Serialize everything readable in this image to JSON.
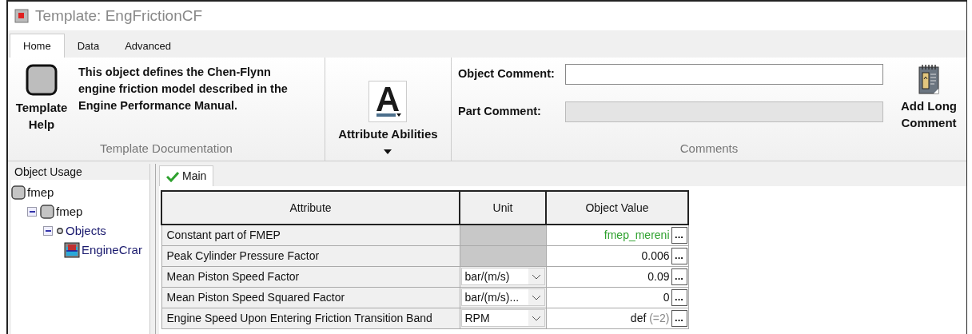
{
  "window": {
    "title": "Template: EngFrictionCF"
  },
  "tabs": [
    {
      "label": "Home",
      "selected": true
    },
    {
      "label": "Data",
      "selected": false
    },
    {
      "label": "Advanced",
      "selected": false
    }
  ],
  "ribbon": {
    "template_help": "Template Help",
    "description": "This object defines the Chen-Flynn engine friction model described in the Engine Performance Manual.",
    "documentation_group": "Template Documentation",
    "attribute_abilities": "Attribute Abilities",
    "comments": [
      {
        "label": "Object Comment:",
        "disabled": false
      },
      {
        "label": "Part Comment:",
        "disabled": true
      }
    ],
    "add_long_comment": "Add Long Comment",
    "comments_group": "Comments"
  },
  "object_usage": {
    "title": "Object Usage",
    "tree": [
      {
        "label": "fmep",
        "kind": "template",
        "children": [
          {
            "label": "fmep",
            "kind": "template",
            "expanded": true,
            "children": [
              {
                "label": "Objects",
                "kind": "folder",
                "expanded": true,
                "children": [
                  {
                    "label": "EngineCrar",
                    "kind": "object"
                  }
                ]
              }
            ]
          }
        ]
      }
    ]
  },
  "main": {
    "tab": "Main",
    "columns": [
      "Attribute",
      "Unit",
      "Object Value"
    ],
    "rows": [
      {
        "attribute": "Constant part of FMEP",
        "unit": {
          "kind": "none"
        },
        "value": {
          "kind": "reference",
          "text": "fmep_mereni"
        },
        "button": "..."
      },
      {
        "attribute": "Peak Cylinder Pressure Factor",
        "unit": {
          "kind": "none"
        },
        "value": {
          "kind": "number",
          "text": "0.006"
        },
        "button": "..."
      },
      {
        "attribute": "Mean Piston Speed Factor",
        "unit": {
          "kind": "dropdown",
          "text": "bar/(m/s)"
        },
        "value": {
          "kind": "number",
          "text": "0.09"
        },
        "button": "..."
      },
      {
        "attribute": "Mean Piston Speed Squared Factor",
        "unit": {
          "kind": "dropdown",
          "text": "bar/(m/s)..."
        },
        "value": {
          "kind": "number",
          "text": "0"
        },
        "button": "..."
      },
      {
        "attribute": "Engine Speed Upon Entering Friction Transition Band",
        "unit": {
          "kind": "dropdown",
          "text": "RPM"
        },
        "value": {
          "kind": "default",
          "text": "def",
          "default": "(=2)"
        },
        "button": "..."
      }
    ]
  }
}
